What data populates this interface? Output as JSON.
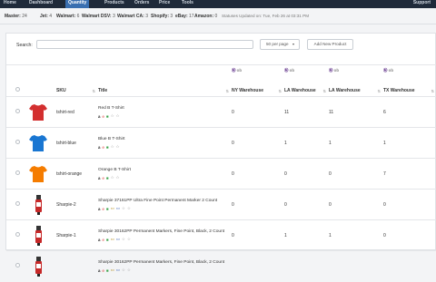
{
  "nav": {
    "items": [
      "Home",
      "Dashboard",
      "Quantity",
      "Products",
      "Orders",
      "Price",
      "Tools"
    ],
    "active": 2,
    "support": "Support"
  },
  "stats": [
    {
      "key": "Master:",
      "val": "24"
    },
    {
      "key": "Jet:",
      "val": "4"
    },
    {
      "key": "Walmart:",
      "val": "6"
    },
    {
      "key": "Walmart DSV:",
      "val": "3"
    },
    {
      "key": "Walmart CA:",
      "val": "3"
    },
    {
      "key": "Shopify:",
      "val": "3"
    },
    {
      "key": "eBay:",
      "val": "17"
    },
    {
      "key": "Amazon:",
      "val": "0"
    }
  ],
  "updated_text": "Statuses Updated on: Tue, Feb 26 at 03:31 PM",
  "toolbar": {
    "search_label": "Search:",
    "per_page": "50 per page",
    "add_button": "Add New Product"
  },
  "columns": {
    "sku": "SKU",
    "title": "Title",
    "warehouses": [
      "NY Warehouse",
      "LA Warehouse",
      "LA Warehouse",
      "TX Warehouse"
    ],
    "wh_icons": [
      "ob",
      "ob",
      "ob",
      "ob"
    ]
  },
  "colors": {
    "accent": "#3a6fb0",
    "red_shirt": "#d32f2f",
    "blue_shirt": "#1976d2",
    "orange_shirt": "#f57c00"
  },
  "rows": [
    {
      "sku": "tshirt-red",
      "title": "Red B T-Shirt",
      "image": "red-tshirt",
      "qty": [
        "0",
        "11",
        "11",
        "6"
      ]
    },
    {
      "sku": "tshirt-blue",
      "title": "Blue B T-Shirt",
      "image": "blue-tshirt",
      "qty": [
        "0",
        "1",
        "1",
        "1"
      ]
    },
    {
      "sku": "tshirt-orange",
      "title": "Orange B T-Shirt",
      "image": "orange-tshirt",
      "qty": [
        "0",
        "0",
        "0",
        "7"
      ]
    },
    {
      "sku": "Sharpie-2",
      "title": "Sharpie 37161PP Ultra Fine Point Permanent Marker 2 Count",
      "image": "sharpie-marker",
      "qty": [
        "0",
        "0",
        "0",
        "0"
      ]
    },
    {
      "sku": "Sharpie-1",
      "title": "Sharpie 30162PP Permanent Markers, Fine Point, Black, 2 Count",
      "image": "sharpie-marker",
      "qty": [
        "0",
        "1",
        "1",
        "0"
      ]
    },
    {
      "sku": "",
      "title": "Sharpie 30162PP Permanent Markers, Fine Point, Black, 2 Count",
      "image": "sharpie-marker",
      "qty": [
        "",
        "",
        "",
        ""
      ]
    }
  ]
}
